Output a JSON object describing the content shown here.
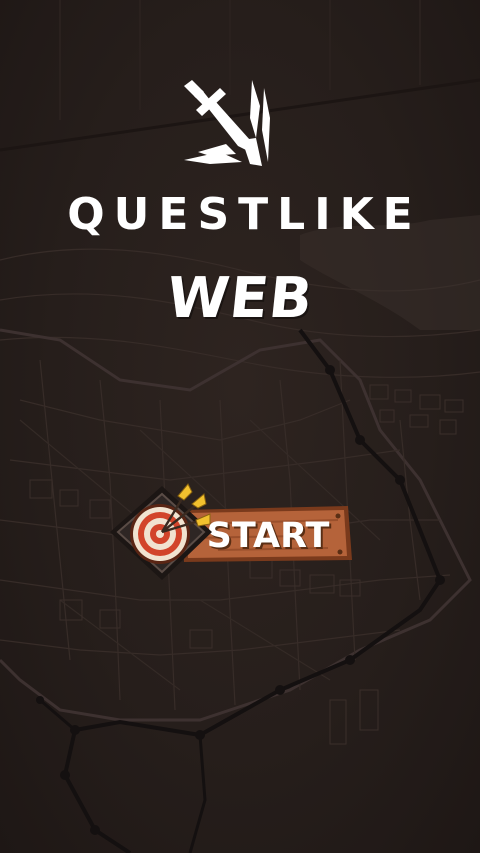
{
  "app": {
    "title": "QUESTLIKE",
    "subtitle": "WEB"
  },
  "menu": {
    "start_label": "START"
  },
  "icons": {
    "logo": "sword-icon",
    "start": "archery-target-icon"
  },
  "colors": {
    "background": "#241c1a",
    "map_lines": "#3a2f2b",
    "plank": "#b5633a",
    "plank_dark": "#7a3a1c",
    "target_red": "#d2452b",
    "arrow_gold": "#f2c12e",
    "text": "#ffffff"
  }
}
